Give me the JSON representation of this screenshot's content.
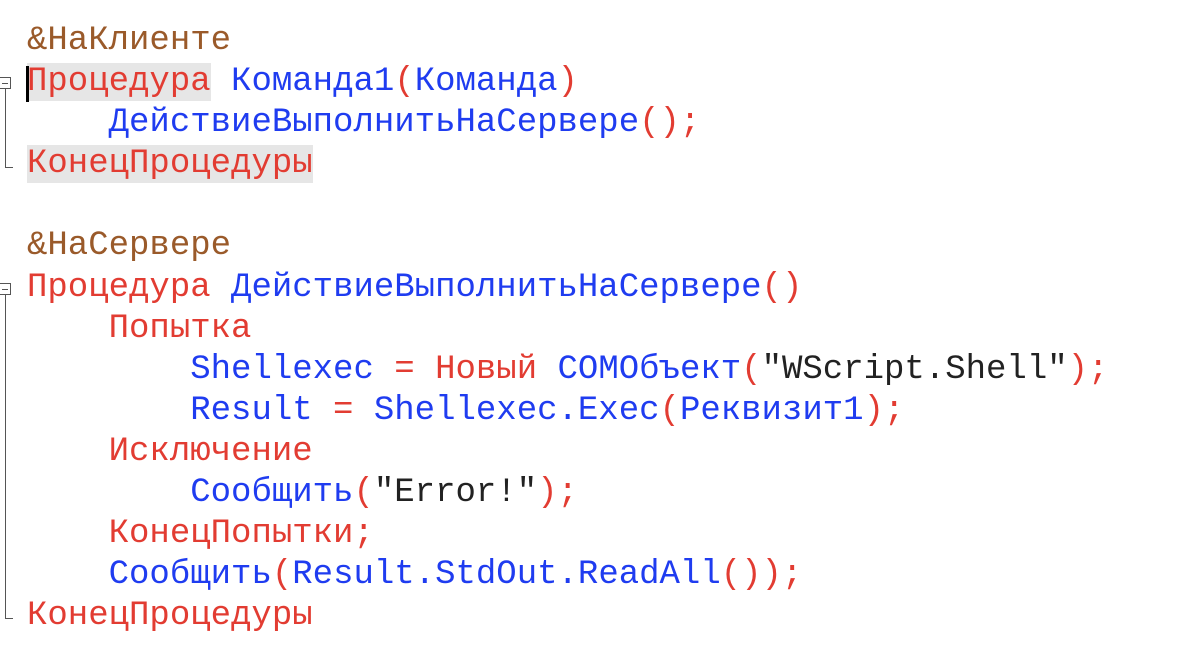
{
  "colors": {
    "preprocessor": "#9a5a2a",
    "keyword": "#e23c32",
    "identifier": "#1f3cf0",
    "string": "#222222",
    "highlight": "#e6e6e6"
  },
  "lines": [
    {
      "indent": 0,
      "tokens": [
        {
          "t": "&НаКлиенте",
          "c": "pre"
        }
      ]
    },
    {
      "indent": 0,
      "tokens": [
        {
          "t": "Процедура",
          "c": "kw",
          "hl": true
        },
        {
          "t": " ",
          "c": "id"
        },
        {
          "t": "Команда1",
          "c": "id"
        },
        {
          "t": "(",
          "c": "kw"
        },
        {
          "t": "Команда",
          "c": "id"
        },
        {
          "t": ")",
          "c": "kw"
        }
      ]
    },
    {
      "indent": 1,
      "tokens": [
        {
          "t": "ДействиеВыполнитьНаСервере",
          "c": "id"
        },
        {
          "t": "();",
          "c": "kw"
        }
      ]
    },
    {
      "indent": 0,
      "tokens": [
        {
          "t": "КонецПроцедуры",
          "c": "kw",
          "hl": true
        }
      ]
    },
    {
      "indent": 0,
      "tokens": []
    },
    {
      "indent": 0,
      "tokens": [
        {
          "t": "&НаСервере",
          "c": "pre"
        }
      ]
    },
    {
      "indent": 0,
      "tokens": [
        {
          "t": "Процедура",
          "c": "kw"
        },
        {
          "t": " ",
          "c": "id"
        },
        {
          "t": "ДействиеВыполнитьНаСервере",
          "c": "id"
        },
        {
          "t": "()",
          "c": "kw"
        }
      ]
    },
    {
      "indent": 1,
      "tokens": [
        {
          "t": "Попытка",
          "c": "kw"
        }
      ]
    },
    {
      "indent": 2,
      "tokens": [
        {
          "t": "Shellexec",
          "c": "id"
        },
        {
          "t": " = ",
          "c": "kw"
        },
        {
          "t": "Новый",
          "c": "kw"
        },
        {
          "t": " ",
          "c": "id"
        },
        {
          "t": "COMОбъект",
          "c": "id"
        },
        {
          "t": "(",
          "c": "kw"
        },
        {
          "t": "\"WScript.Shell\"",
          "c": "str"
        },
        {
          "t": ");",
          "c": "kw"
        }
      ]
    },
    {
      "indent": 2,
      "tokens": [
        {
          "t": "Result",
          "c": "id"
        },
        {
          "t": " = ",
          "c": "kw"
        },
        {
          "t": "Shellexec.Exec",
          "c": "id"
        },
        {
          "t": "(",
          "c": "kw"
        },
        {
          "t": "Реквизит1",
          "c": "id"
        },
        {
          "t": ");",
          "c": "kw"
        }
      ]
    },
    {
      "indent": 1,
      "tokens": [
        {
          "t": "Исключение",
          "c": "kw"
        }
      ]
    },
    {
      "indent": 2,
      "tokens": [
        {
          "t": "Сообщить",
          "c": "id"
        },
        {
          "t": "(",
          "c": "kw"
        },
        {
          "t": "\"Error!\"",
          "c": "str"
        },
        {
          "t": ");",
          "c": "kw"
        }
      ]
    },
    {
      "indent": 1,
      "tokens": [
        {
          "t": "КонецПопытки;",
          "c": "kw"
        }
      ]
    },
    {
      "indent": 1,
      "tokens": [
        {
          "t": "Сообщить",
          "c": "id"
        },
        {
          "t": "(",
          "c": "kw"
        },
        {
          "t": "Result.StdOut.ReadAll",
          "c": "id"
        },
        {
          "t": "());",
          "c": "kw"
        }
      ]
    },
    {
      "indent": 0,
      "tokens": [
        {
          "t": "КонецПроцедуры",
          "c": "kw"
        }
      ]
    }
  ]
}
